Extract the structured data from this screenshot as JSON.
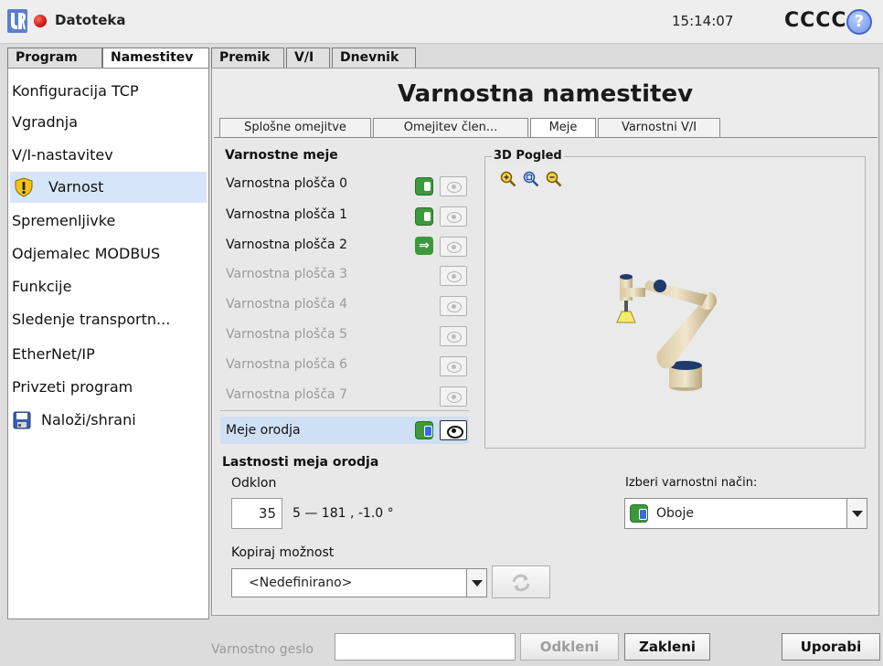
{
  "topbar": {
    "file_menu": "Datoteka",
    "time": "15:14:07",
    "robot_name": "CCCC",
    "help_glyph": "?"
  },
  "main_tabs": [
    "Program",
    "Namestitev",
    "Premik",
    "V/I",
    "Dnevnik"
  ],
  "sidebar": {
    "items": [
      {
        "label": "Konfiguracija TCP"
      },
      {
        "label": "Vgradnja"
      },
      {
        "label": "V/I-nastavitev"
      },
      {
        "label": "Varnost",
        "icon": "warning-shield-icon"
      },
      {
        "label": "Spremenljivke"
      },
      {
        "label": "Odjemalec MODBUS"
      },
      {
        "label": "Funkcije"
      },
      {
        "label": "Sledenje transportn..."
      },
      {
        "label": "EtherNet/IP"
      },
      {
        "label": "Privzeti program"
      },
      {
        "label": "Naloži/shrani",
        "icon": "floppy-disk-icon"
      }
    ]
  },
  "page_title": "Varnostna namestitev",
  "sub_tabs": [
    "Splošne omejitve",
    "Omejitev člen...",
    "Meje",
    "Varnostni V/I"
  ],
  "boundaries": {
    "heading": "Varnostne meje",
    "planes": [
      {
        "label": "Varnostna plošča 0",
        "state": "enabled"
      },
      {
        "label": "Varnostna plošča 1",
        "state": "enabled"
      },
      {
        "label": "Varnostna plošča 2",
        "state": "trigger"
      },
      {
        "label": "Varnostna plošča 3",
        "state": "disabled"
      },
      {
        "label": "Varnostna plošča 4",
        "state": "disabled"
      },
      {
        "label": "Varnostna plošča 5",
        "state": "disabled"
      },
      {
        "label": "Varnostna plošča 6",
        "state": "disabled"
      },
      {
        "label": "Varnostna plošča 7",
        "state": "disabled"
      }
    ],
    "tool_row_label": "Meje orodja"
  },
  "view3d": {
    "title": "3D Pogled",
    "zoom_icons": [
      "zoom-in-icon",
      "zoom-fit-icon",
      "zoom-out-icon"
    ]
  },
  "tool_props": {
    "heading": "Lastnosti meja orodja",
    "deviation_label": "Odklon",
    "deviation_value": "35",
    "deviation_range": "5 — 181 , -1.0 °",
    "copy_label": "Kopiraj možnost",
    "copy_selected": "<Nedefinirano>",
    "mode_label": "Izberi varnostni način:",
    "mode_selected": "Oboje"
  },
  "bottombar": {
    "password_label": "Varnostno geslo",
    "password_value": "",
    "unlock_label": "Odkleni",
    "lock_label": "Zakleni",
    "apply_label": "Uporabi"
  },
  "colors": {
    "accent_blue": "#3a6ae0",
    "toggle_green": "#3c9a3c",
    "selection_blue": "#d6e6f8"
  }
}
